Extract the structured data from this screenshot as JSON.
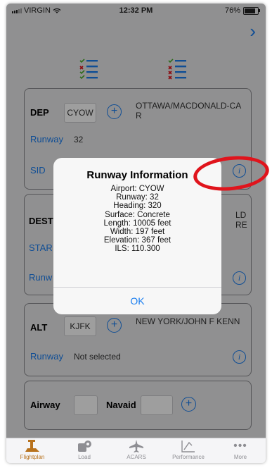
{
  "status_bar": {
    "carrier": "VIRGIN",
    "time": "12:32 PM",
    "battery": "76%"
  },
  "nav": {
    "next_icon": "chevron-right-icon"
  },
  "dep": {
    "label": "DEP",
    "code": "CYOW",
    "name": "OTTAWA/MACDONALD-CA R",
    "runway_label": "Runway",
    "runway_value": "32",
    "sid_label": "SID"
  },
  "dest": {
    "label": "DEST",
    "name_partial": "LD RE",
    "star_label": "STAR",
    "runway_label": "Runw"
  },
  "alt": {
    "label": "ALT",
    "code": "KJFK",
    "name": "NEW YORK/JOHN F KENN",
    "runway_label": "Runway",
    "runway_value": "Not selected"
  },
  "route": {
    "airway_label": "Airway",
    "navaid_label": "Navaid"
  },
  "dialog": {
    "title": "Runway Information",
    "lines": [
      "Airport: CYOW",
      "Runway: 32",
      "Heading: 320",
      "Surface: Concrete",
      "Length: 10005 feet",
      "Width: 197 feet",
      "Elevation: 367 feet",
      "ILS: 110.300"
    ],
    "ok_label": "OK"
  },
  "tabs": [
    {
      "label": "Flightplan",
      "icon": "flightplan-icon",
      "active": true
    },
    {
      "label": "Load",
      "icon": "load-icon",
      "active": false
    },
    {
      "label": "ACARS",
      "icon": "airplane-icon",
      "active": false
    },
    {
      "label": "Performance",
      "icon": "performance-icon",
      "active": false
    },
    {
      "label": "More",
      "icon": "more-icon",
      "active": false
    }
  ],
  "colors": {
    "accent": "#1a7ef0",
    "annotation": "#e0141c",
    "active_tab": "#b8721d"
  }
}
